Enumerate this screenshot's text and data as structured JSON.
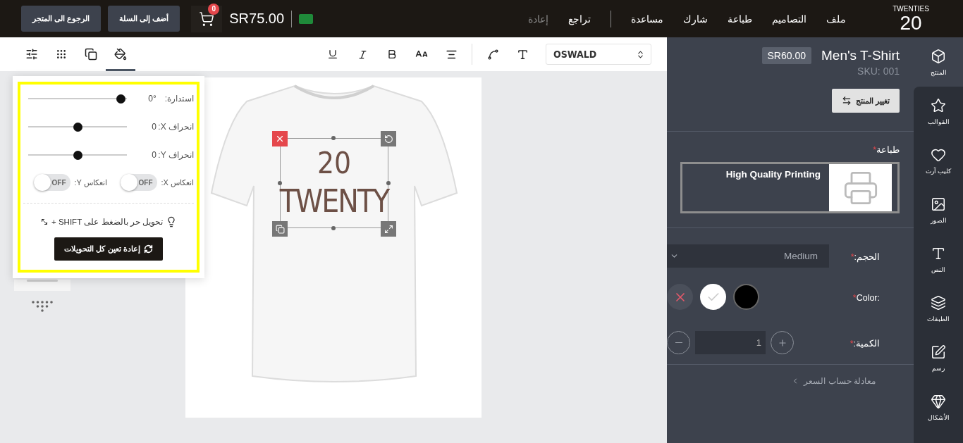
{
  "header": {
    "logo": {
      "number": "20",
      "word": "TWENTIES"
    },
    "menu": [
      {
        "label": "ملف"
      },
      {
        "label": "التصاميم"
      },
      {
        "label": "طباعة"
      },
      {
        "label": "شارك"
      },
      {
        "label": "مساعدة"
      }
    ],
    "history": [
      {
        "label": "تراجع",
        "disabled": false
      },
      {
        "label": "إعادة",
        "disabled": true
      }
    ],
    "total": "SR75.00",
    "cart_count": "0",
    "buttons": [
      {
        "label": "أضف إلى السلة"
      },
      {
        "label": "الرجوع الى المتجر"
      }
    ]
  },
  "toolbar": {
    "tabs": [
      {
        "kind": "adjust",
        "selected": false
      },
      {
        "kind": "grid",
        "selected": false
      },
      {
        "kind": "arrange",
        "selected": false
      },
      {
        "kind": "fill",
        "selected": true
      }
    ],
    "font": "OSWALD"
  },
  "popover": {
    "sliders": [
      {
        "label": "استدارة:",
        "reading": "0°",
        "level": 0.94
      },
      {
        "label": "انحراف X:",
        "reading": "0",
        "level": 0.5
      },
      {
        "label": "انحراف Y:",
        "reading": "0",
        "level": 0.5
      }
    ],
    "toggles": [
      {
        "label": "انعكاس X:",
        "state_label": "OFF",
        "on": false
      },
      {
        "label": "انعكاس Y:",
        "state_label": "OFF",
        "on": false
      }
    ],
    "hint": "تحويل حر بالضغط على SHIFT +",
    "reset_button": "إعادة تعين كل التحويلات"
  },
  "canvas": {
    "design_lines": [
      "20",
      "TWENTY"
    ]
  },
  "product": {
    "title": "Men's T-Shirt",
    "price": "SR60.00",
    "sku": "SKU: 001",
    "change_button": "تغيير المنتج",
    "print_label": "طباعة",
    "print_mark": "*",
    "print_options": [
      {
        "label": "High Quality Printing",
        "selected": true
      }
    ],
    "size_label": "الحجم:",
    "size_mark": "*",
    "size_value": "Medium",
    "color_label": "Color:",
    "color_mark": "*",
    "colors": [
      {
        "kind": "none",
        "selected": false
      },
      {
        "kind": "swatch",
        "color": "#ffffff",
        "selected": true
      },
      {
        "kind": "swatch",
        "color": "#000000",
        "selected": false
      }
    ],
    "quantity_label": "الكمية:",
    "quantity_mark": "*",
    "quantity": "1",
    "price_formula": "معادلة حساب السعر"
  },
  "sidebar": {
    "items": [
      {
        "label": "المنتج",
        "kind": "product",
        "selected": true
      },
      {
        "label": "القوالب",
        "kind": "templates",
        "selected": false
      },
      {
        "label": "كليب آرت",
        "kind": "clipart",
        "selected": false
      },
      {
        "label": "الصور",
        "kind": "images",
        "selected": false
      },
      {
        "label": "النص",
        "kind": "text",
        "selected": false
      },
      {
        "label": "الطبقات",
        "kind": "layers",
        "selected": false
      },
      {
        "label": "رسم",
        "kind": "draw",
        "selected": false
      },
      {
        "label": "الأشكال",
        "kind": "shapes",
        "selected": false
      }
    ]
  }
}
